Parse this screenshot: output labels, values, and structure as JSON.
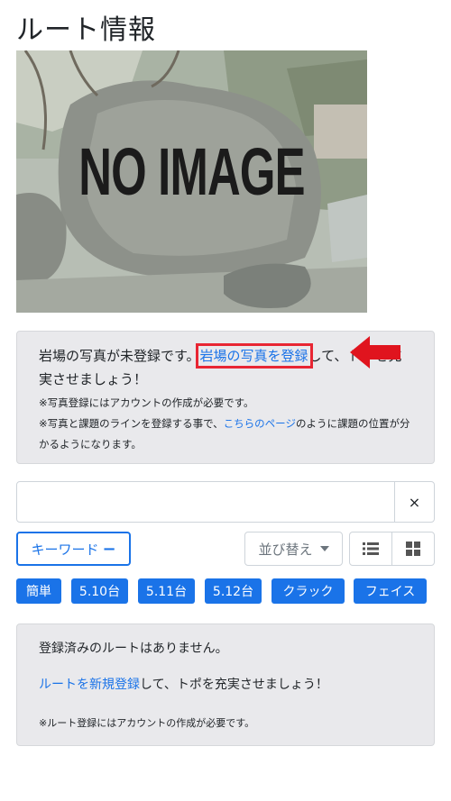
{
  "page": {
    "title": "ルート情報"
  },
  "photo": {
    "placeholder_text": "NO IMAGE"
  },
  "notice": {
    "text_before": "岩場の写真が未登録です。",
    "register_photo_link": "岩場の写真を登録",
    "text_after": "して、トポを充実させましょう！",
    "note_account": "※写真登録にはアカウントの作成が必要です。",
    "note_lines_prefix": "※写真と課題のラインを登録する事で、",
    "note_lines_link": "こちらのページ",
    "note_lines_suffix": "のように課題の位置が分かるようになります。"
  },
  "search": {
    "value": "",
    "placeholder": "",
    "clear_label": "×"
  },
  "filters": {
    "keyword_label": "キーワード",
    "sort_label": "並び替え",
    "tags": [
      "簡単",
      "5.10台",
      "5.11台",
      "5.12台",
      "クラック",
      "フェイス"
    ]
  },
  "empty_state": {
    "message": "登録済みのルートはありません。",
    "register_link": "ルートを新規登録",
    "register_suffix": "して、トポを充実させましょう！",
    "note": "※ルート登録にはアカウントの作成が必要です。"
  },
  "colors": {
    "accent": "#1a73e8",
    "highlight_box": "#e82633",
    "arrow": "#e0141e"
  },
  "icons": {
    "list_view": "list-icon",
    "grid_view": "grid-icon",
    "arrow": "arrow-left-icon"
  }
}
